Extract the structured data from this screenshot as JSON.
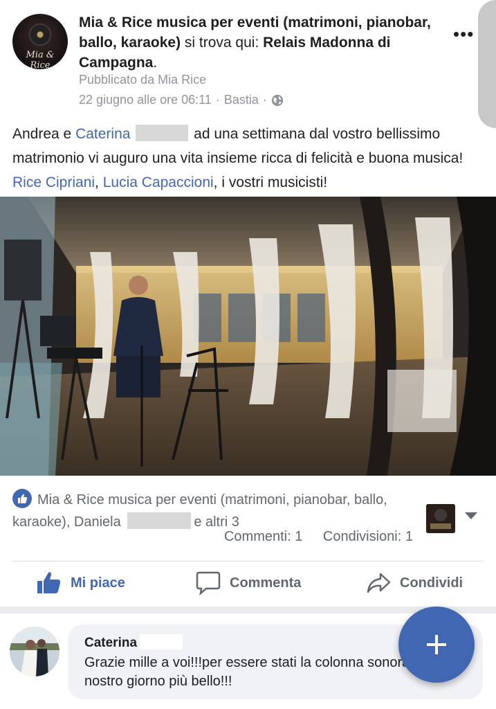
{
  "post": {
    "page_name": "Mia & Rice musica per eventi (matrimoni, pianobar, ballo, karaoke)",
    "location_prefix": "si trova qui:",
    "location": "Relais Madonna di Campagna",
    "period": ".",
    "published_by": "Pubblicato da Mia Rice",
    "date": "22 giugno alle ore 06:11",
    "separator": "·",
    "place": "Bastia",
    "more_label": "•••",
    "avatar_text": "Mia & Rice",
    "text": {
      "part1": "Andrea e",
      "tag1": "Caterina",
      "part2": "ad una settimana dal vostro bellissimo matrimonio vi auguro una vita insieme ricca di felicità e buona musica!",
      "tag2": "Rice Cipriani",
      "comma": ",",
      "tag3": "Lucia Capaccioni",
      "part3": ", i vostri musicisti!"
    }
  },
  "reactions": {
    "names_part1": "Mia & Rice musica per eventi (matrimoni, pianobar, ballo, karaoke), Daniela",
    "names_part2": "e altri 3",
    "comments": "Commenti: 1",
    "shares": "Condivisioni: 1"
  },
  "actions": {
    "like": "Mi piace",
    "comment": "Commenta",
    "share": "Condividi"
  },
  "comment": {
    "author": "Caterina",
    "text": "Grazie mille a voi!!!per essere stati la colonna sonora del nostro giorno più bello!!!"
  },
  "colors": {
    "accent": "#4267b2",
    "meta": "#90949c"
  }
}
